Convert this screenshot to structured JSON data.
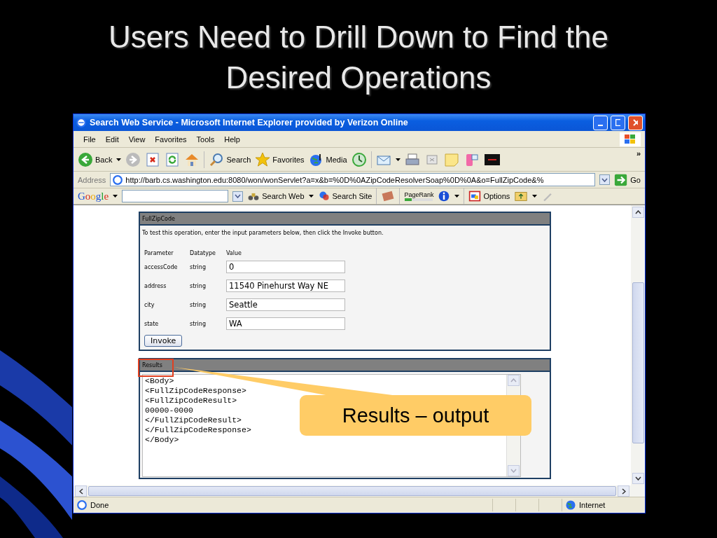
{
  "slide": {
    "title_lines": [
      "Users Need to Drill Down to Find the",
      "Desired Operations"
    ]
  },
  "window": {
    "title": "Search Web Service - Microsoft Internet Explorer provided by Verizon Online"
  },
  "menu": [
    "File",
    "Edit",
    "View",
    "Favorites",
    "Tools",
    "Help"
  ],
  "toolbar": {
    "back": "Back",
    "search": "Search",
    "favorites": "Favorites",
    "media": "Media",
    "more": "»"
  },
  "address": {
    "label": "Address",
    "value": "http://barb.cs.washington.edu:8080/won/wonServlet?a=x&b=%0D%0AZipCodeResolverSoap%0D%0A&o=FullZipCode&%",
    "go": "Go"
  },
  "google_bar": {
    "logo": "Google",
    "search_web": "Search Web",
    "search_site": "Search Site",
    "pagerank": "PageRank",
    "options": "Options"
  },
  "operation": {
    "title": "FullZipCode",
    "instructions": "To test this operation, enter the input parameters below, then click the Invoke button.",
    "columns": [
      "Parameter",
      "Datatype",
      "Value"
    ],
    "params": [
      {
        "name": "accessCode",
        "type": "string",
        "value": "0"
      },
      {
        "name": "address",
        "type": "string",
        "value": "11540 Pinehurst Way NE"
      },
      {
        "name": "city",
        "type": "string",
        "value": "Seattle"
      },
      {
        "name": "state",
        "type": "string",
        "value": "WA"
      }
    ],
    "button": "Invoke"
  },
  "results": {
    "title": "Results",
    "lines": [
      "<Body>",
      "<FullZipCodeResponse>",
      "<FullZipCodeResult>",
      "00000-0000",
      "</FullZipCodeResult>",
      "</FullZipCodeResponse>",
      "</Body>"
    ]
  },
  "callout": {
    "text": "Results – output"
  },
  "status_bar": {
    "text": "Done",
    "zone": "Internet"
  }
}
